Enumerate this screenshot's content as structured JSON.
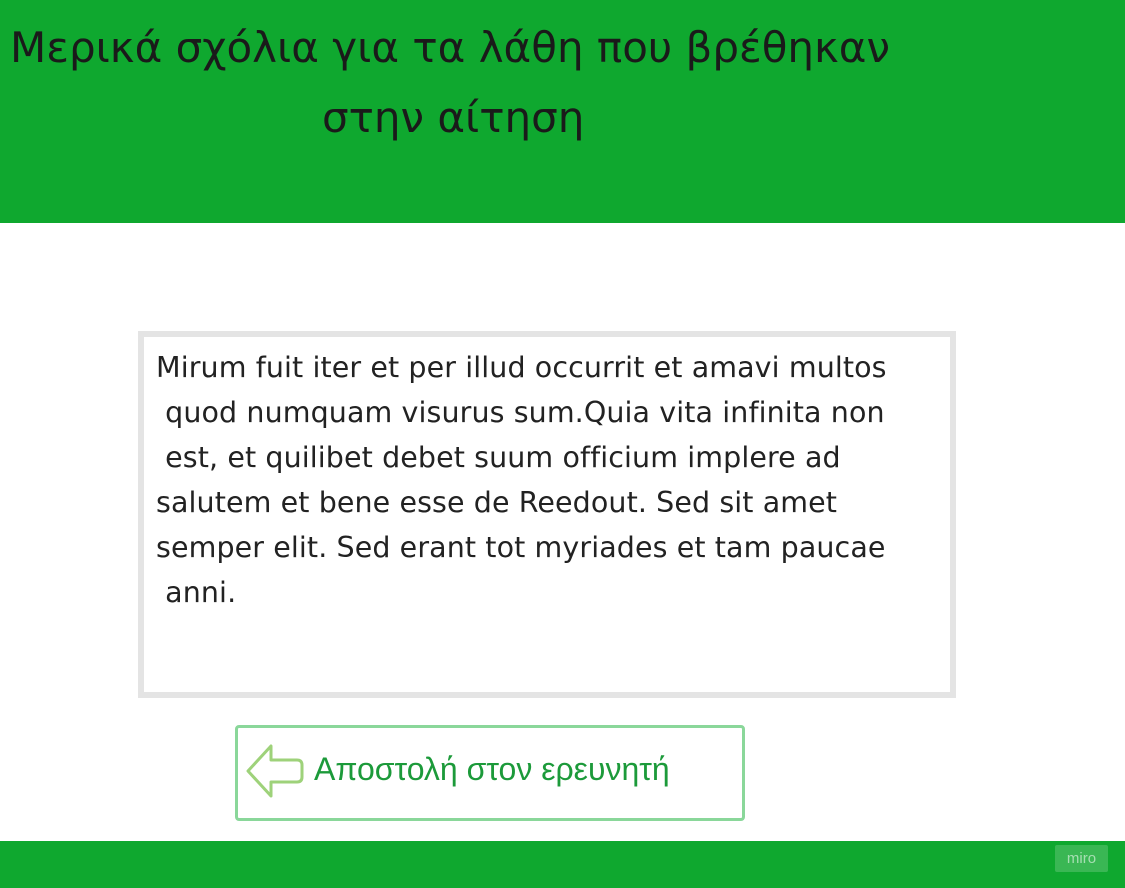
{
  "header": {
    "title_line1": "Μερικά σχόλια για τα λάθη που βρέθηκαν",
    "title_line2": "στην αίτηση",
    "background_color": "#0fa82f"
  },
  "comment": {
    "text": "Mirum fuit iter et per illud occurrit et amavi multos\n quod numquam visurus sum.Quia vita infinita non\n est, et quilibet debet suum officium implere ad\nsalutem et bene esse de Reedout. Sed sit amet\nsemper elit. Sed erant tot myriades et tam paucae\n anni."
  },
  "actions": {
    "send_label": "Αποστολή στον ερευνητή",
    "send_icon": "arrow-left-icon",
    "accent_color": "#1c9a3a"
  },
  "footer": {
    "badge": "miro"
  }
}
